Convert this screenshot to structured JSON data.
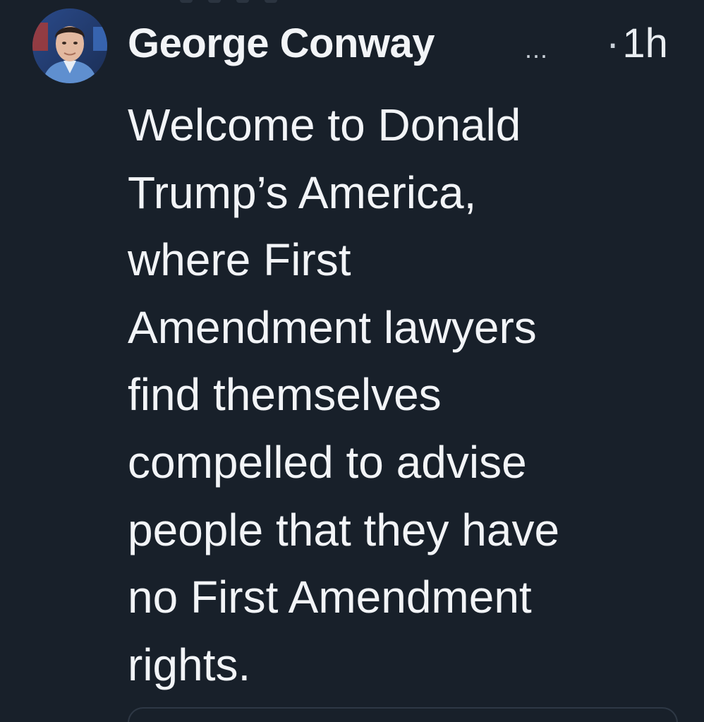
{
  "post": {
    "author": {
      "name": "George Conway",
      "name_truncation": "...",
      "avatar_icon": "profile-photo-icon"
    },
    "timestamp_separator": "·",
    "timestamp": "1h",
    "text_lines": [
      "Welcome to Donald",
      "Trump’s America,",
      "where First",
      "Amendment lawyers",
      "find themselves",
      "compelled to advise",
      "people that they have",
      "no First Amendment",
      "rights."
    ]
  },
  "colors": {
    "background": "#18202a",
    "text_primary": "#f2f4f7",
    "text_secondary": "#c9d0d8",
    "card_border": "#2e3845"
  }
}
